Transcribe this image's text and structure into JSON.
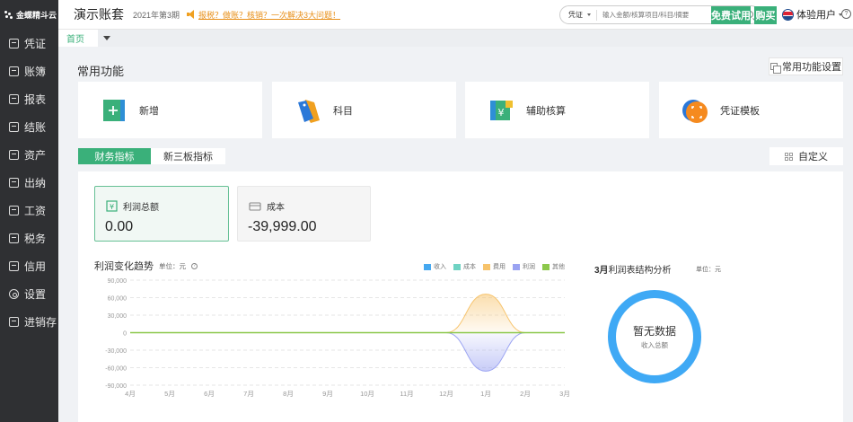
{
  "brand": {
    "name": "金蝶精斗云"
  },
  "sidebar": {
    "items": [
      {
        "label": "凭证",
        "icon": "voucher-icon"
      },
      {
        "label": "账簿",
        "icon": "ledger-icon"
      },
      {
        "label": "报表",
        "icon": "report-icon"
      },
      {
        "label": "结账",
        "icon": "close-books-icon"
      },
      {
        "label": "资产",
        "icon": "asset-icon"
      },
      {
        "label": "出纳",
        "icon": "cashier-icon"
      },
      {
        "label": "工资",
        "icon": "payroll-icon"
      },
      {
        "label": "税务",
        "icon": "tax-icon"
      },
      {
        "label": "信用",
        "icon": "credit-icon"
      },
      {
        "label": "设置",
        "icon": "gear-icon"
      },
      {
        "label": "进销存",
        "icon": "inventory-icon"
      }
    ]
  },
  "topbar": {
    "account_name": "演示账套",
    "period": "2021年第3期",
    "promo": "报税？做账？核销？一次解决3大问题！",
    "search_type": "凭证",
    "search_placeholder": "输入金额/核算项目/科目/摘要",
    "free_trial": "免费试用",
    "buy": "购买",
    "user": "体验用户",
    "help": "?"
  },
  "tabs": {
    "home": "首页"
  },
  "main": {
    "section_title": "常用功能",
    "func_settings": "常用功能设置",
    "cards": [
      {
        "label": "新增",
        "icon": "add-voucher-icon"
      },
      {
        "label": "科目",
        "icon": "subject-tags-icon"
      },
      {
        "label": "辅助核算",
        "icon": "auxiliary-accounting-icon"
      },
      {
        "label": "凭证模板",
        "icon": "voucher-template-icon"
      }
    ],
    "kpi_tabs": [
      "财务指标",
      "新三板指标"
    ],
    "customize": "自定义",
    "kpis": [
      {
        "label": "利润总额",
        "value": "0.00"
      },
      {
        "label": "成本",
        "value": "-39,999.00"
      }
    ],
    "trend_title": "利润变化趋势",
    "trend_unit": "单位：元",
    "pie_title_month": "3月",
    "pie_title": "利润表结构分析",
    "pie_unit": "单位：元",
    "pie_empty": "暂无数据",
    "pie_sub": "收入总额"
  },
  "colors": {
    "accent": "#3ab07a",
    "sidebar": "#2f3033",
    "donut": "#3fa9f5",
    "income": "#45a8f0",
    "cost": "#6fd3c3",
    "expense": "#f7c36b",
    "profit": "#9aa3f2",
    "other": "#8cc84b"
  },
  "chart_data": {
    "type": "area",
    "categories": [
      "4月",
      "5月",
      "6月",
      "7月",
      "8月",
      "9月",
      "10月",
      "11月",
      "12月",
      "1月",
      "2月",
      "3月"
    ],
    "ylim": [
      -90000,
      90000
    ],
    "yticks": [
      "90,000",
      "60,000",
      "30,000",
      "0",
      "-30,000",
      "-60,000",
      "-90,000"
    ],
    "series": [
      {
        "name": "收入",
        "color": "#45a8f0",
        "values": [
          0,
          0,
          0,
          0,
          0,
          0,
          0,
          0,
          0,
          0,
          0,
          0
        ]
      },
      {
        "name": "成本",
        "color": "#6fd3c3",
        "values": [
          0,
          0,
          0,
          0,
          0,
          0,
          0,
          0,
          0,
          0,
          0,
          0
        ]
      },
      {
        "name": "费用",
        "color": "#f7c36b",
        "values": [
          0,
          0,
          0,
          0,
          0,
          0,
          0,
          0,
          0,
          66000,
          0,
          0
        ]
      },
      {
        "name": "利润",
        "color": "#9aa3f2",
        "values": [
          0,
          0,
          0,
          0,
          0,
          0,
          0,
          0,
          0,
          -66000,
          0,
          0
        ]
      },
      {
        "name": "其他",
        "color": "#8cc84b",
        "values": [
          0,
          0,
          0,
          0,
          0,
          0,
          0,
          0,
          0,
          0,
          0,
          0
        ]
      }
    ]
  }
}
